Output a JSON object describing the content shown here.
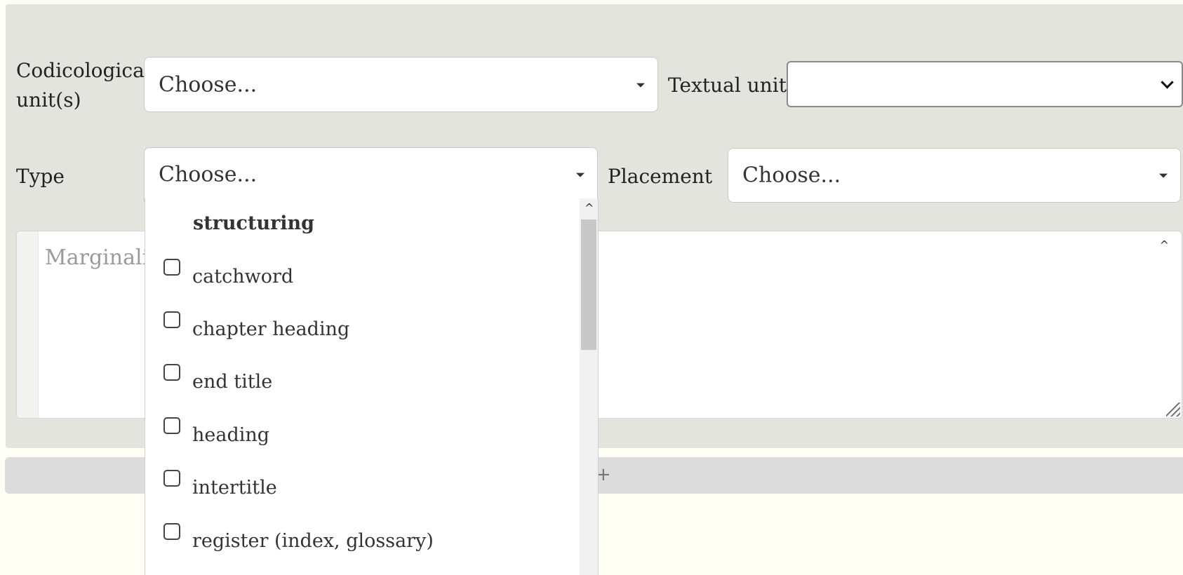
{
  "form": {
    "codicological_label_line1": "Codicological",
    "codicological_label_line2": "unit(s)",
    "codicological_value": "Choose...",
    "textual_unit_label": "Textual unit",
    "textual_unit_value": "",
    "type_label": "Type",
    "type_value": "Choose...",
    "placement_label": "Placement",
    "placement_value": "Choose...",
    "marginalia_placeholder": "Marginali"
  },
  "type_dropdown": {
    "group_label": "structuring",
    "options": [
      {
        "label": "catchword",
        "checked": false
      },
      {
        "label": "chapter heading",
        "checked": false
      },
      {
        "label": "end title",
        "checked": false
      },
      {
        "label": "heading",
        "checked": false
      },
      {
        "label": "intertitle",
        "checked": false
      },
      {
        "label": "register (index, glossary)",
        "checked": false
      }
    ]
  },
  "add_bar": {
    "icon": "plus-icon",
    "glyph": "+"
  }
}
